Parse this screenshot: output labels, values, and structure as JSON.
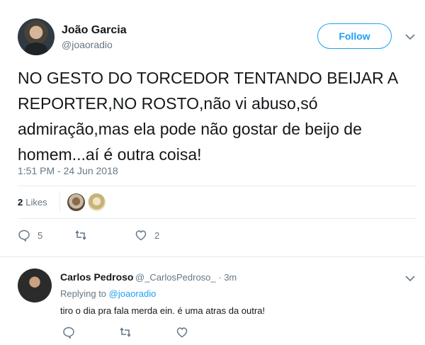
{
  "tweet": {
    "author_name": "João Garcia",
    "author_handle": "@joaoradio",
    "follow_label": "Follow",
    "text": "NO GESTO DO TORCEDOR TENTANDO BEIJAR A REPORTER,NO ROSTO,não vi abuso,só admiração,mas ela pode não gostar de beijo de homem...aí é outra coisa!",
    "timestamp": "1:51 PM - 24 Jun 2018",
    "likes_count": "2",
    "likes_label": "Likes",
    "reply_count": "5",
    "retweet_count": "",
    "like_count": "2"
  },
  "reply": {
    "author_name": "Carlos Pedroso",
    "author_handle": "@_CarlosPedroso_ · 3m",
    "replying_prefix": "Replying to ",
    "replying_to": "@joaoradio",
    "text": "tiro o dia pra fala merda ein. é uma atras da outra!"
  },
  "icons": {
    "more": "chevron-down-icon",
    "reply": "reply-icon",
    "retweet": "retweet-icon",
    "like": "heart-icon"
  },
  "colors": {
    "accent": "#1da1f2",
    "muted": "#657786",
    "divider": "#e6ecf0"
  }
}
